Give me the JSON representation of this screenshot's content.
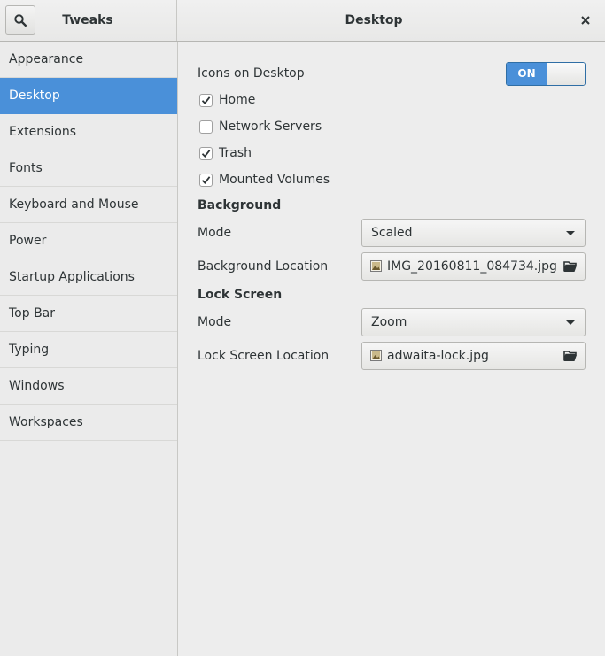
{
  "header": {
    "app_title": "Tweaks",
    "page_title": "Desktop",
    "search_icon": "search-icon",
    "close_icon": "close-icon"
  },
  "sidebar": {
    "items": [
      {
        "label": "Appearance",
        "selected": false
      },
      {
        "label": "Desktop",
        "selected": true
      },
      {
        "label": "Extensions",
        "selected": false
      },
      {
        "label": "Fonts",
        "selected": false
      },
      {
        "label": "Keyboard and Mouse",
        "selected": false
      },
      {
        "label": "Power",
        "selected": false
      },
      {
        "label": "Startup Applications",
        "selected": false
      },
      {
        "label": "Top Bar",
        "selected": false
      },
      {
        "label": "Typing",
        "selected": false
      },
      {
        "label": "Windows",
        "selected": false
      },
      {
        "label": "Workspaces",
        "selected": false
      }
    ],
    "selected_color": "#4a90d9"
  },
  "desktop": {
    "icons_label": "Icons on Desktop",
    "icons_switch": "ON",
    "checks": [
      {
        "label": "Home",
        "checked": true
      },
      {
        "label": "Network Servers",
        "checked": false
      },
      {
        "label": "Trash",
        "checked": true
      },
      {
        "label": "Mounted Volumes",
        "checked": true
      }
    ]
  },
  "background": {
    "heading": "Background",
    "mode_label": "Mode",
    "mode_value": "Scaled",
    "location_label": "Background Location",
    "location_file": "IMG_20160811_084734.jpg"
  },
  "lock_screen": {
    "heading": "Lock Screen",
    "mode_label": "Mode",
    "mode_value": "Zoom",
    "location_label": "Lock Screen Location",
    "location_file": "adwaita-lock.jpg"
  }
}
